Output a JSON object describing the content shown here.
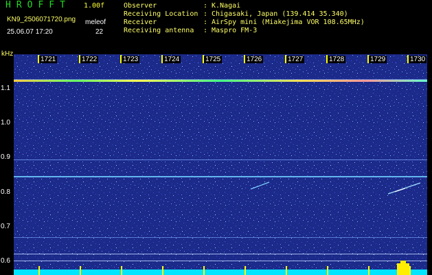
{
  "header": {
    "app_title": "HROFFT",
    "version": "1.00f",
    "file_name": "KN9_2506071720.png",
    "mode": "meleof",
    "datetime": "25.06.07 17:20",
    "count": "22"
  },
  "info": [
    {
      "key": "Observer",
      "value": "K.Nagai"
    },
    {
      "key": "Receiving Location",
      "value": "Chigasaki, Japan (139.414 35.340)"
    },
    {
      "key": "Receiver",
      "value": "AirSpy mini (Miakejima VOR 108.65MHz)"
    },
    {
      "key": "Receiving antenna",
      "value": "Maspro FM-3"
    }
  ],
  "axis": {
    "unit": "kHz",
    "y_labels": [
      "1.1",
      "1.0",
      "0.9",
      "0.8",
      "0.7",
      "0.6"
    ],
    "time_labels": [
      "1721",
      "1722",
      "1723",
      "1724",
      "1725",
      "1726",
      "1727",
      "1728",
      "1729",
      "1730"
    ]
  },
  "colors": {
    "background": "#000000",
    "spectrogram": "#1c2a8a",
    "title": "#22dd22",
    "tick": "#ffff00",
    "info_text": "#ffff66",
    "baseline": "#00e5ff"
  }
}
